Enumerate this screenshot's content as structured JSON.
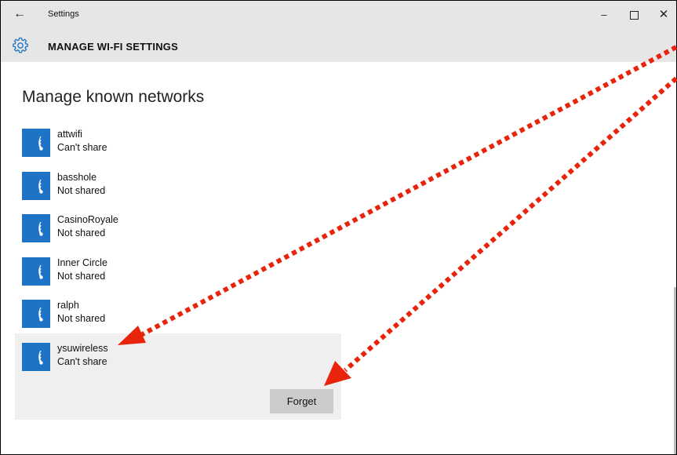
{
  "window": {
    "title": "Settings",
    "back_glyph": "←",
    "minimize_glyph": "–",
    "close_glyph": "✕"
  },
  "header": {
    "icon": "gear-icon",
    "title": "MANAGE WI-FI SETTINGS"
  },
  "main": {
    "title": "Manage known networks",
    "networks": [
      {
        "name": "attwifi",
        "status": "Can't share",
        "icon": "wifi-icon"
      },
      {
        "name": "basshole",
        "status": "Not shared",
        "icon": "wifi-icon"
      },
      {
        "name": "CasinoRoyale",
        "status": "Not shared",
        "icon": "wifi-icon"
      },
      {
        "name": "Inner Circle",
        "status": "Not shared",
        "icon": "wifi-icon"
      },
      {
        "name": "ralph",
        "status": "Not shared",
        "icon": "wifi-icon"
      },
      {
        "name": "ysuwireless",
        "status": "Can't share",
        "icon": "wifi-icon",
        "selected": true
      }
    ],
    "forget_label": "Forget"
  },
  "colors": {
    "accent": "#1f73c6",
    "annotation_arrow": "#e8250c",
    "titlebar_bg": "#e6e6e6",
    "selected_bg": "#efefef",
    "button_bg": "#cccccc"
  }
}
